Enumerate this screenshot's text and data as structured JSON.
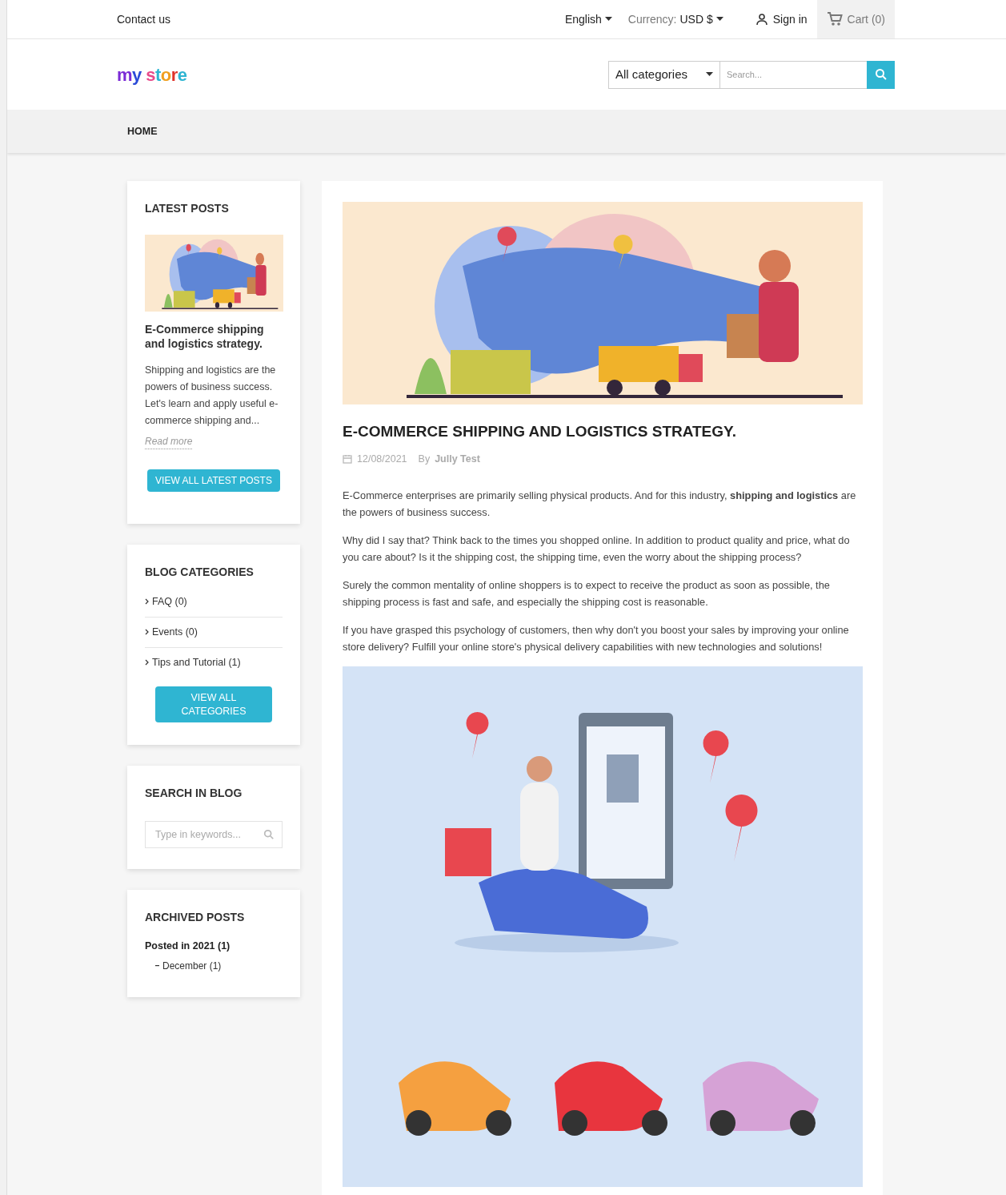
{
  "top_bar": {
    "contact": "Contact us",
    "language": "English",
    "currency_label": "Currency:",
    "currency": "USD $",
    "sign_in": "Sign in",
    "cart": "Cart (0)"
  },
  "header": {
    "logo": "my store",
    "category_select": "All categories",
    "search": {
      "placeholder": "Search..."
    }
  },
  "breadcrumb": [
    "HOME"
  ],
  "sidebar": {
    "latest_posts": {
      "title": "LATEST POSTS",
      "post_title": "E-Commerce shipping and logistics strategy.",
      "excerpt": "Shipping and logistics are the powers of business success. Let's learn and apply useful e-commerce shipping and...",
      "read_more": "Read more",
      "button": "VIEW ALL LATEST POSTS"
    },
    "blog_categories": {
      "title": "BLOG CATEGORIES",
      "items": [
        "FAQ (0)",
        "Events (0)",
        "Tips and Tutorial (1)"
      ],
      "button": "VIEW ALL CATEGORIES"
    },
    "search_in_blog": {
      "title": "SEARCH IN BLOG",
      "placeholder": "Type in keywords..."
    },
    "archived_posts": {
      "title": "ARCHIVED POSTS",
      "years": [
        {
          "label": "Posted in 2021 (1)",
          "months": [
            "December (1)"
          ]
        }
      ]
    }
  },
  "post": {
    "title": "E-COMMERCE SHIPPING AND LOGISTICS STRATEGY.",
    "date": "12/08/2021",
    "by": "By",
    "author": "Jully Test",
    "paragraphs": [
      "E-Commerce enterprises are primarily selling physical products. And for this industry, **shipping and logistics** are the powers of business success.",
      "Why did I say that? Think back to the times you shopped online. In addition to product quality and price, what do you care about? Is it the shipping cost, the shipping time, even the worry about the shipping process?",
      "Surely the common mentality of online shoppers is to expect to receive the product as soon as possible, the shipping process is fast and safe, and especially the shipping cost is reasonable.",
      "If you have grasped this psychology of customers, then why don't you boost your sales by improving your online store delivery? Fulfill your online store's physical delivery capabilities with new technologies and solutions!"
    ]
  }
}
